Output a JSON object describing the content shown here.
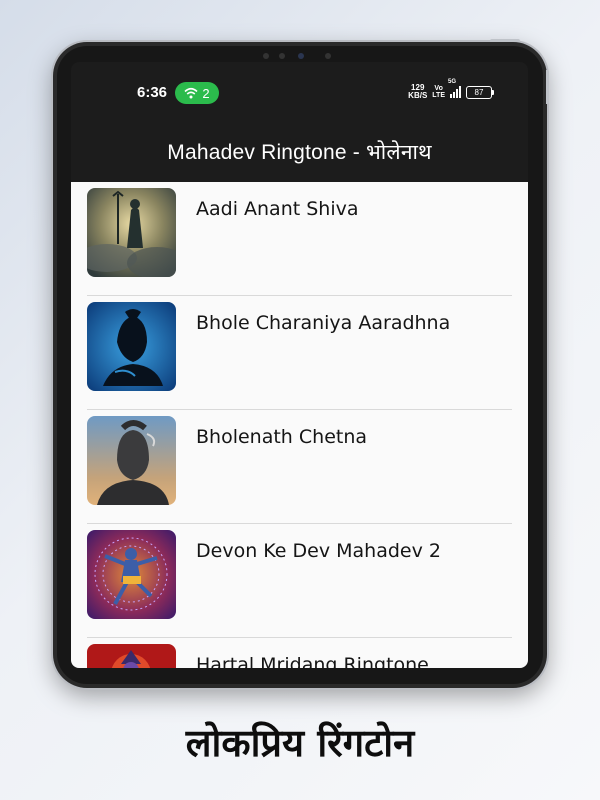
{
  "status_bar": {
    "time": "6:36",
    "hotspot_count": "2",
    "speed_value": "129",
    "speed_unit": "KB/S",
    "volte_top": "Vo",
    "volte_bottom": "LTE",
    "network": "5G",
    "battery": "87",
    "hotspot_color": "#2bbb4c"
  },
  "app_bar": {
    "title": "Mahadev Ringtone - भोलेनाथ"
  },
  "ringtones": [
    {
      "title": "Aadi Anant Shiva"
    },
    {
      "title": "Bhole Charaniya Aaradhna"
    },
    {
      "title": "Bholenath Chetna"
    },
    {
      "title": "Devon Ke Dev Mahadev 2"
    },
    {
      "title": "Hartal Mridang Ringtone"
    }
  ],
  "caption": "लोकप्रिय रिंगटोन"
}
